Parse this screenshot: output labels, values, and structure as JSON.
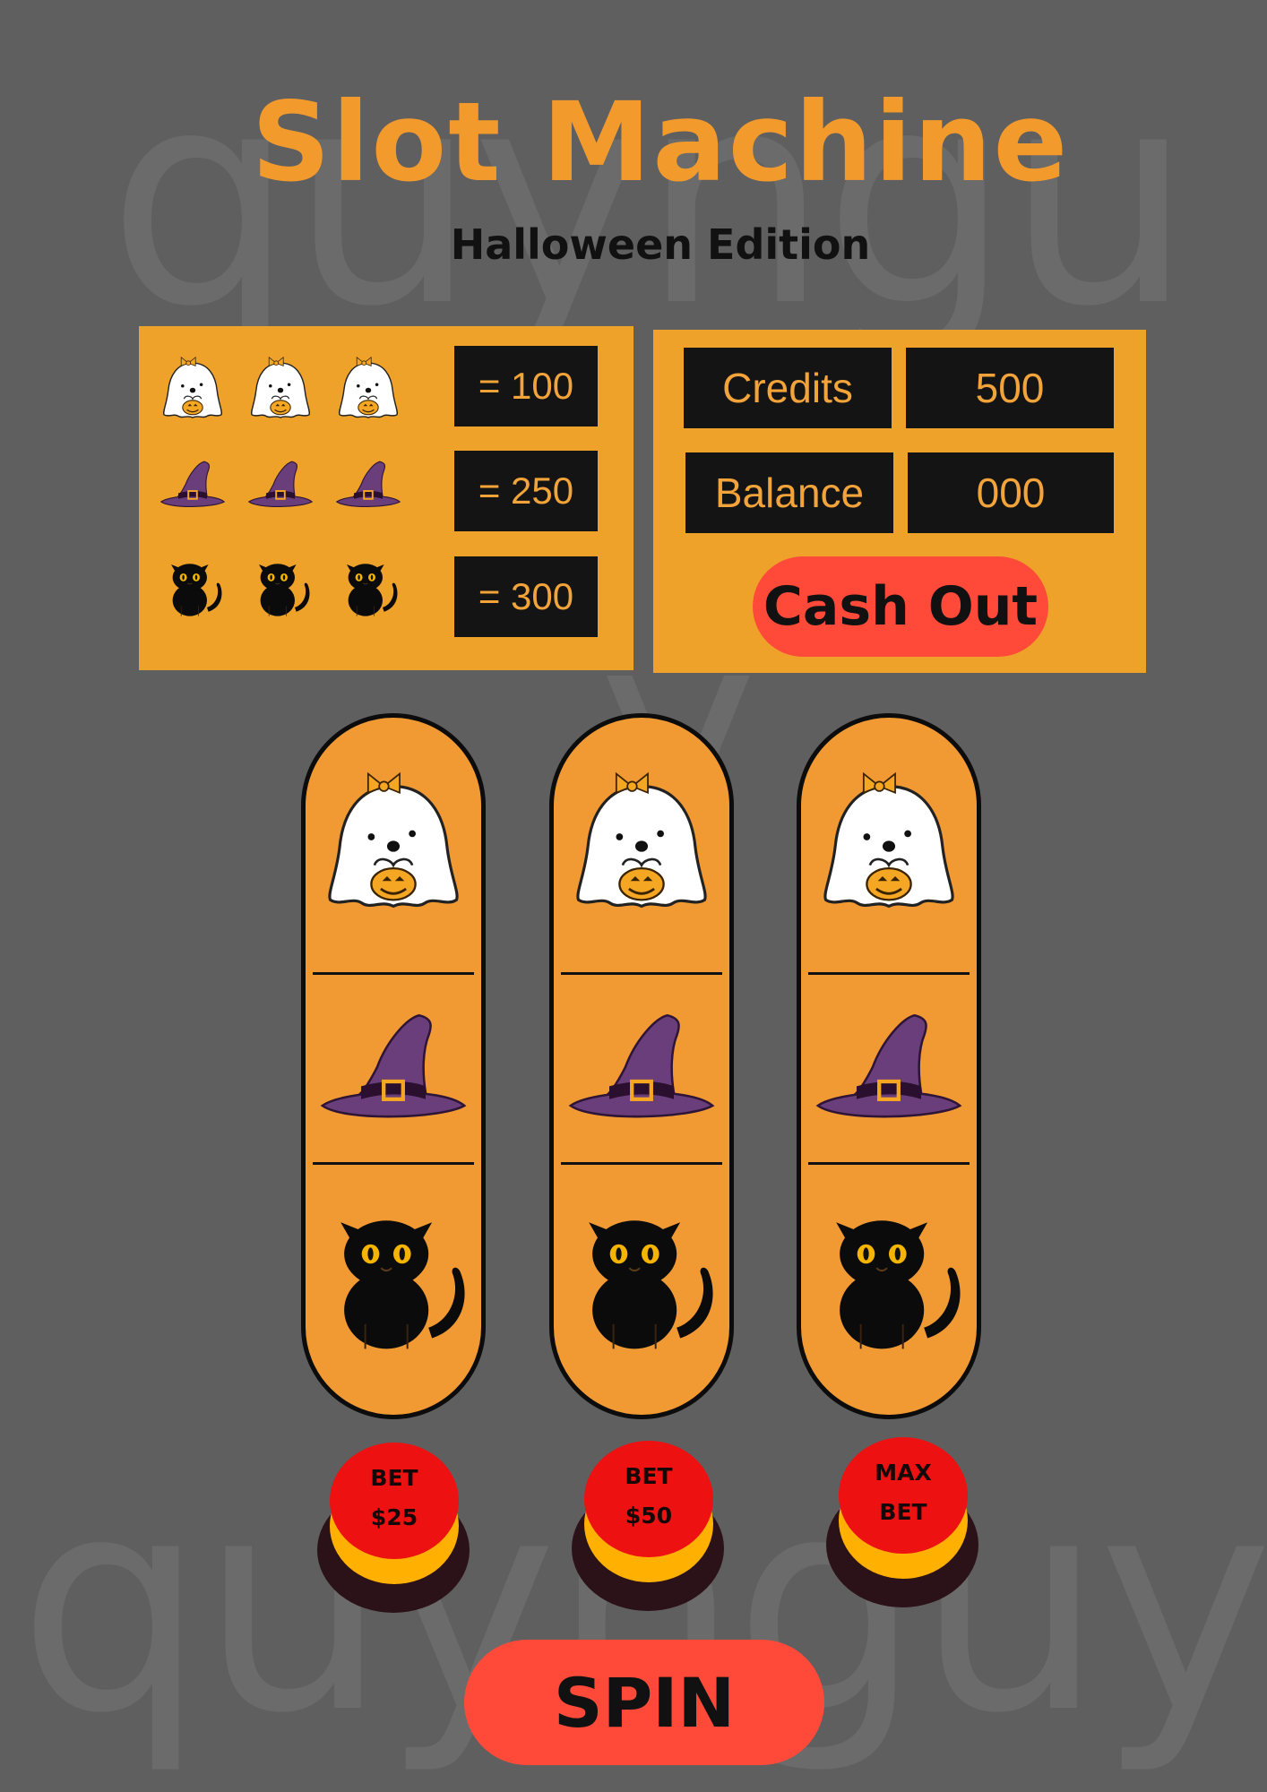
{
  "watermark": {
    "top": "quyngu",
    "middle": "y",
    "bottom": "quynguy"
  },
  "header": {
    "title": "Slot Machine",
    "subtitle": "Halloween Edition"
  },
  "paytable": {
    "rows": [
      {
        "symbol": "ghost-icon",
        "value": "= 100"
      },
      {
        "symbol": "witch-hat-icon",
        "value": "= 250"
      },
      {
        "symbol": "black-cat-icon",
        "value": "= 300"
      }
    ]
  },
  "account": {
    "credits_label": "Credits",
    "credits_value": "500",
    "balance_label": "Balance",
    "balance_value": "000",
    "cash_out_label": "Cash Out"
  },
  "reels": [
    [
      "ghost-icon",
      "witch-hat-icon",
      "black-cat-icon"
    ],
    [
      "ghost-icon",
      "witch-hat-icon",
      "black-cat-icon"
    ],
    [
      "ghost-icon",
      "witch-hat-icon",
      "black-cat-icon"
    ]
  ],
  "bet_buttons": [
    {
      "line1": "BET",
      "line2": "$25"
    },
    {
      "line1": "BET",
      "line2": "$50"
    },
    {
      "line1": "MAX",
      "line2": "BET"
    }
  ],
  "spin_label": "SPIN",
  "colors": {
    "background": "#5f5f5f",
    "accent_orange": "#f39a2c",
    "button_red": "#ff4a3a",
    "display_black": "#141414"
  }
}
